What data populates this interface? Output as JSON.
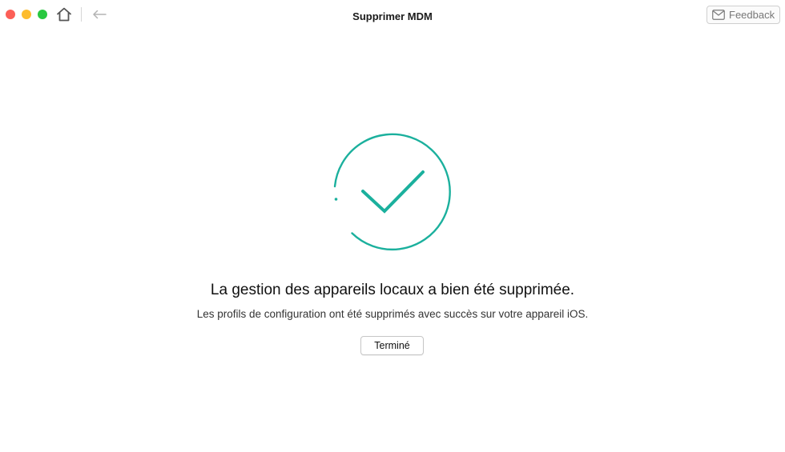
{
  "window": {
    "title": "Supprimer MDM",
    "controls": [
      "close",
      "minimize",
      "zoom"
    ]
  },
  "toolbar": {
    "home_icon": "home-icon",
    "back_icon": "back-arrow-icon",
    "feedback_label": "Feedback",
    "feedback_icon": "mail-icon"
  },
  "main": {
    "status_icon": "success-check-icon",
    "headline": "La gestion des appareils locaux a bien été supprimée.",
    "message": "Les profils de configuration ont été supprimés avec succès sur votre appareil iOS.",
    "done_label": "Terminé"
  },
  "colors": {
    "accent": "#1bb09d",
    "traffic_close": "#fc5f57",
    "traffic_minimize": "#fdbc2e",
    "traffic_zoom": "#28c840"
  }
}
